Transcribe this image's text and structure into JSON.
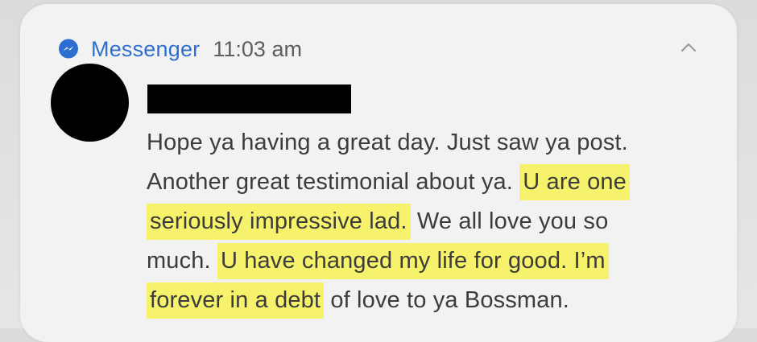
{
  "notification": {
    "app_name": "Messenger",
    "time": "11:03 am",
    "app_icon": "messenger-icon",
    "collapse_icon": "chevron-up-icon",
    "sender_name_redacted": true,
    "avatar_redacted": true,
    "message": {
      "line1": [
        {
          "text": "Hope ya having a great day. Just saw ya post.",
          "highlight": false
        }
      ],
      "line2": [
        {
          "text": "Another great testimonial about ya. ",
          "highlight": false
        },
        {
          "text": "U are one",
          "highlight": true
        }
      ],
      "line3": [
        {
          "text": "seriously impressive lad.",
          "highlight": true
        },
        {
          "text": " We all love you so",
          "highlight": false
        }
      ],
      "line4": [
        {
          "text": "much. ",
          "highlight": false
        },
        {
          "text": "U have changed my life for good. I’m",
          "highlight": true
        }
      ],
      "line5": [
        {
          "text": "forever in a debt",
          "highlight": true
        },
        {
          "text": " of love to ya Bossman.",
          "highlight": false
        }
      ]
    }
  },
  "colors": {
    "brand_blue": "#2d6fd1",
    "highlight_yellow": "#f6f26b",
    "card_background": "#f2f2f2",
    "text": "#3c3c3c"
  }
}
